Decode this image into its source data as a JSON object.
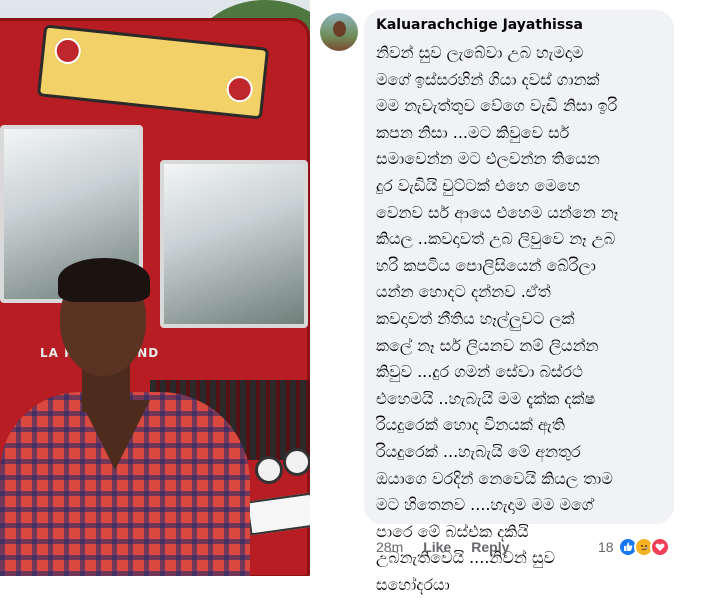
{
  "comment": {
    "author": "Kaluarachchige Jayathissa",
    "lines": [
      "නිවන් සුව ලැබේවා උබ හැමදාම",
      "මගේ ඉස්සරහින් ගියා දවස් ගානක්",
      "මම නැවැත්තුව වේගෙ වැඩි නිසා ඉරි",
      "කපන නිසා ...මට කිවුවෙ සර්",
      "සමාවෙන්න මට එලවන්න තියෙන",
      "දුර වැඩියි චුට්ටක් එහෙ මෙහෙ",
      "වෙනව සර් ආයෙ එහෙම යන්නෙ නෑ",
      "කියල ..කවදාවත් උබ ලිවුවෙ නෑ උබ",
      "හරි කපටිය පොලිසියෙන් බේරිලා",
      "යන්න හොදට දන්නව  .ඒත්",
      "කවදාවත් නීතිය හෑල්ලුවට ලක්",
      "කලේ නෑ සර් ලියනව නම් ලියන්න",
      "කිවුව ...දුර ගමන් සේවා බස්රථ",
      "එහෙමයි ..හැබැයි මම දැක්ක දක්ෂ",
      "රියදුරෙක් හොද විනයක් ඇති",
      "රියදුරෙක් ...හැබැයි මේ අනතුර",
      "ඔයාගෙ වරදින් නෙවෙයි කියල තාම",
      "මට හිතෙනව ....හැදාම මම මගේ",
      "පාරෙ මේ බස්එක දකියි",
      "උබනැතිවෙයි ....නිවන් සුව",
      "සහෝදරයා"
    ]
  },
  "actions": {
    "time": "28m",
    "like": "Like",
    "reply": "Reply"
  },
  "reactions": {
    "count": "18",
    "icons": [
      "like-icon",
      "sad-icon",
      "love-icon"
    ],
    "colors": {
      "like": "#1877f2",
      "sad": "#f7b125",
      "love": "#f33e58"
    }
  },
  "photo": {
    "bus_brand": "LA           K - LEYLAND"
  }
}
